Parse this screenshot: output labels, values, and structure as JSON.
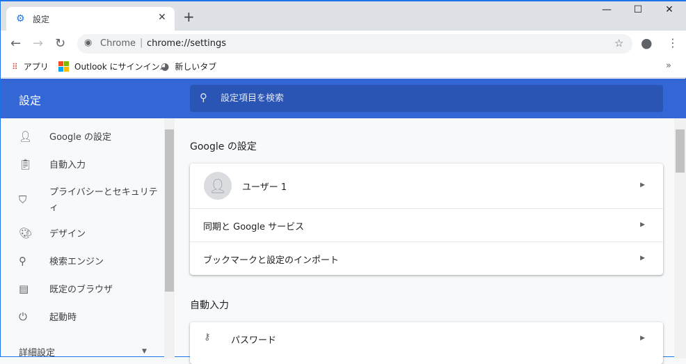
{
  "tab": {
    "title": "設定",
    "close": "✕",
    "new_tab": "+"
  },
  "window": {
    "minimize": "—",
    "maximize": "☐",
    "close": "✕"
  },
  "toolbar": {
    "chip": "Chrome",
    "separator": "|",
    "url": "chrome://settings"
  },
  "bookmarks": [
    {
      "label": "アプリ"
    },
    {
      "label": "Outlook にサインイン..."
    },
    {
      "label": "新しいタブ"
    }
  ],
  "bookmarks_more": "»",
  "header": {
    "title": "設定",
    "search_placeholder": "設定項目を検索"
  },
  "sidebar": {
    "items": [
      {
        "label": "Google の設定",
        "icon": "person-icon"
      },
      {
        "label": "自動入力",
        "icon": "clipboard-icon"
      },
      {
        "label": "プライバシーとセキュリティ",
        "icon": "shield-icon"
      },
      {
        "label": "デザイン",
        "icon": "palette-icon"
      },
      {
        "label": "検索エンジン",
        "icon": "search-icon"
      },
      {
        "label": "既定のブラウザ",
        "icon": "browser-icon"
      },
      {
        "label": "起動時",
        "icon": "power-icon"
      }
    ],
    "advanced": "詳細設定"
  },
  "main": {
    "section1": "Google の設定",
    "user": "ユーザー 1",
    "sync": "同期と Google サービス",
    "import": "ブックマークと設定のインポート",
    "section2": "自動入力",
    "password": "パスワード"
  }
}
